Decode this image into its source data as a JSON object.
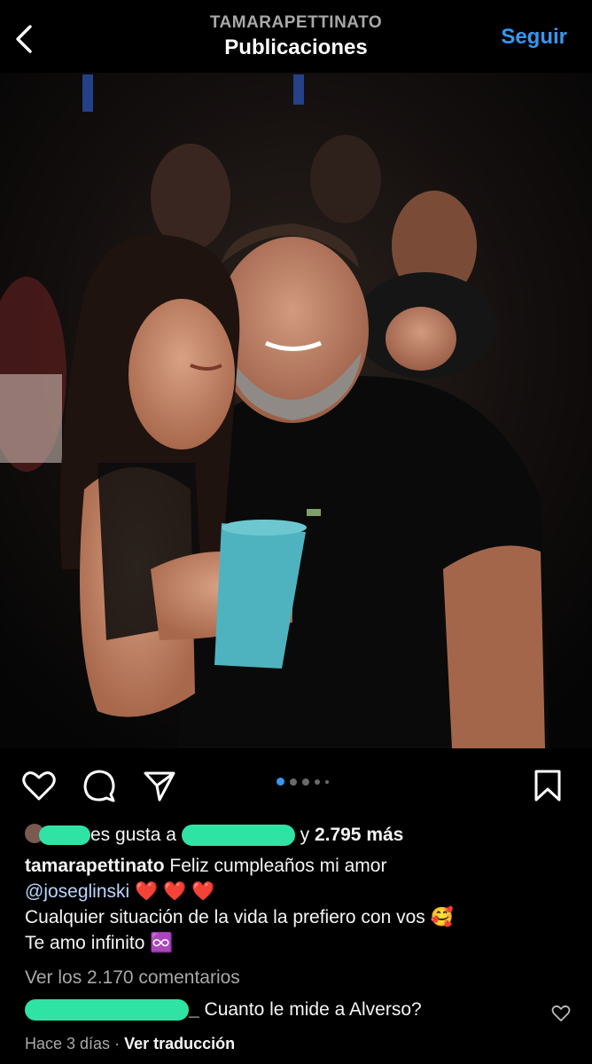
{
  "header": {
    "username": "TAMARAPETTINATO",
    "title": "Publicaciones",
    "follow_label": "Seguir",
    "back_icon": "chevron-left-icon"
  },
  "photo": {
    "description_alt": "Foto de publicación"
  },
  "actions": {
    "icons": [
      "heart-icon",
      "comment-icon",
      "share-icon",
      "bookmark-icon"
    ],
    "carousel_count": 5,
    "carousel_active": 1
  },
  "likes": {
    "prefix": "es gusta a",
    "suffix": "y",
    "count": "2.795 más"
  },
  "caption": {
    "author": "tamarapettinato",
    "text1": "Feliz cumpleaños mi amor",
    "mention": "@joseglinski",
    "hearts": "❤️ ❤️ ❤️",
    "line2": "Cualquier situación de la vida la prefiero con vos 🥰",
    "line3": "Te amo infinito ♾️"
  },
  "comments": {
    "view_all": "Ver los 2.170 comentarios",
    "first_comment_user_tail": "_",
    "first_comment_text": "Cuanto le mide a Alverso?"
  },
  "meta": {
    "time": "Hace 3 días",
    "separator": "·",
    "translate": "Ver traducción"
  },
  "colors": {
    "accent": "#3897f0",
    "background": "#000000",
    "redaction": "#2fe3a5"
  }
}
